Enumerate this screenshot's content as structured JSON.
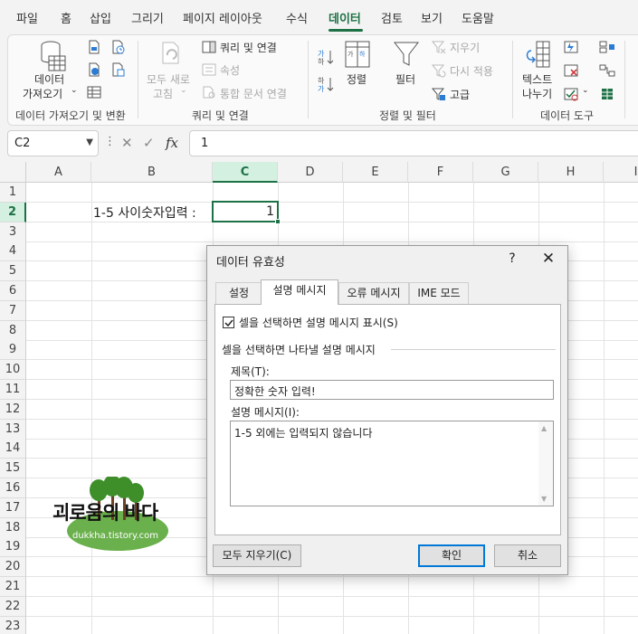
{
  "menu": {
    "tabs": [
      "파일",
      "홈",
      "삽입",
      "그리기",
      "페이지 레이아웃",
      "수식",
      "데이터",
      "검토",
      "보기",
      "도움말"
    ],
    "active": "데이터"
  },
  "ribbon": {
    "get_data_label": "데이터",
    "get_data_label2": "가져오기",
    "refresh_all_label": "모두 새로",
    "refresh_all_label2": "고침",
    "queries_connections": "쿼리 및 연결",
    "properties": "속성",
    "edit_links": "통합 문서 연결",
    "sort_label": "정렬",
    "filter_label": "필터",
    "clear_label": "지우기",
    "reapply_label": "다시 적용",
    "advanced_label": "고급",
    "text_to_columns_label": "텍스트",
    "text_to_columns_label2": "나누기",
    "groups": {
      "get_transform": "데이터 가져오기 및 변환",
      "queries": "쿼리 및 연결",
      "sort_filter": "정렬 및 필터",
      "data_tools": "데이터 도구"
    }
  },
  "formula_bar": {
    "name_box": "C2",
    "formula": "1"
  },
  "sheet": {
    "columns": [
      "A",
      "B",
      "C",
      "D",
      "E",
      "F",
      "G",
      "H",
      "I"
    ],
    "rows": [
      "1",
      "2",
      "3",
      "4",
      "5",
      "6",
      "7",
      "8",
      "9",
      "10",
      "11",
      "12",
      "13",
      "14",
      "15",
      "16",
      "17",
      "18",
      "19",
      "20",
      "21",
      "22",
      "23"
    ],
    "selected_column": "C",
    "selected_row": "2",
    "b2_text": "1-5 사이숫자입력 :",
    "c2_value": "1"
  },
  "watermark": {
    "title": "괴로움의 바다",
    "url": "dukkha.tistory.com"
  },
  "dialog": {
    "title": "데이터 유효성",
    "help": "?",
    "close": "✕",
    "tabs": [
      "설정",
      "설명 메시지",
      "오류 메시지",
      "IME 모드"
    ],
    "active_tab": "설명 메시지",
    "checkbox_label": "셀을 선택하면 설명 메시지 표시(S)",
    "checkbox_checked": true,
    "section_label": "셀을 선택하면 나타낼 설명 메시지",
    "title_field_label": "제목(T):",
    "title_field_value": "정확한 숫자 입력!",
    "message_field_label": "설명 메시지(I):",
    "message_field_value": "1-5 외에는 입력되지 않습니다",
    "clear_all_button": "모두 지우기(C)",
    "ok_button": "확인",
    "cancel_button": "취소"
  }
}
